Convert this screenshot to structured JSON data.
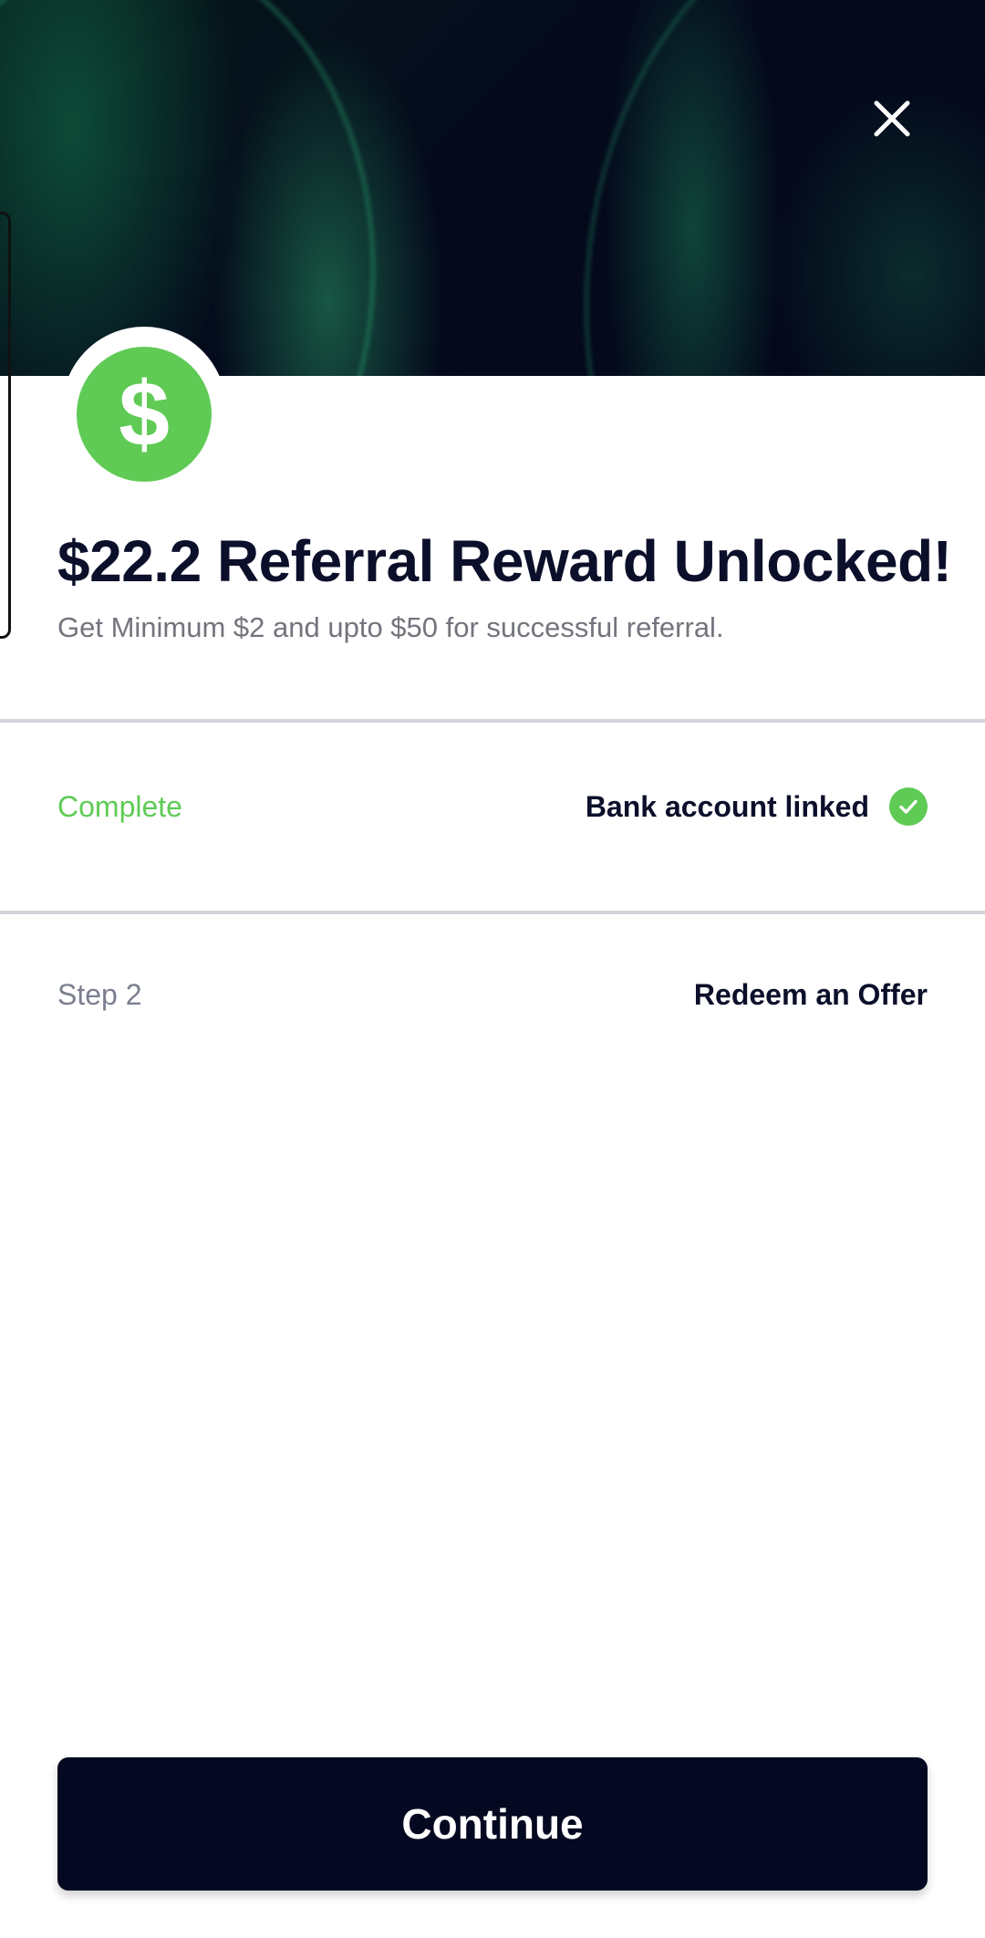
{
  "header": {
    "close_icon": "close-icon"
  },
  "reward": {
    "icon": "dollar-coin-icon",
    "symbol": "$",
    "title": "$22.2 Referral Reward Unlocked!",
    "subtitle": "Get Minimum $2 and upto $50 for successful referral."
  },
  "steps": [
    {
      "status": "Complete",
      "label": "Bank account linked",
      "completed": true,
      "status_color": "#5fcb55"
    },
    {
      "status": "Step 2",
      "label": "Redeem an Offer",
      "completed": false,
      "status_color": "#7b7f8f"
    }
  ],
  "actions": {
    "continue_label": "Continue"
  },
  "colors": {
    "accent_green": "#5fcb55",
    "dark_navy": "#050821",
    "title_text": "#0b0f2a"
  }
}
